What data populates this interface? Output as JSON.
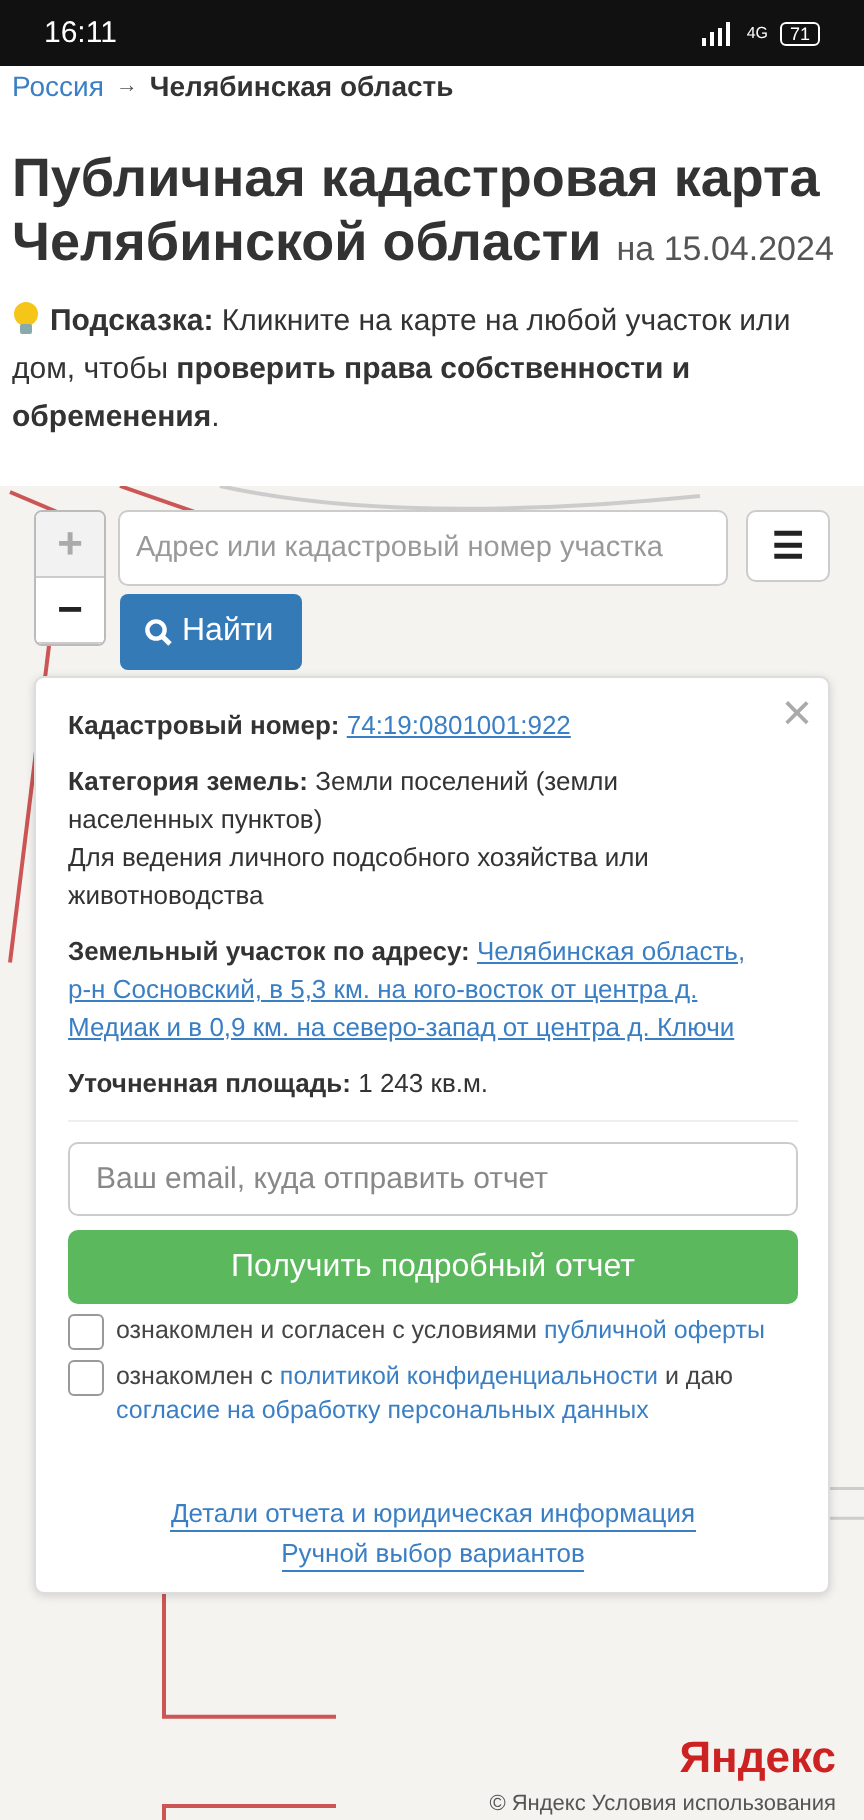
{
  "status_bar": {
    "time": "16:11",
    "network": "4G",
    "battery": "71"
  },
  "breadcrumb": [
    {
      "label": "Россия",
      "current": false
    },
    {
      "label": "Челябинская область",
      "current": true
    }
  ],
  "breadcrumb_separator": "→",
  "title": "Публичная кадастровая карта Челябинской области",
  "title_date": "на 15.04.2024",
  "hint": "**Подсказка:** Кликните на карте на любой участок или дом, чтобы **проверить права собственности и обременения**.",
  "map": {
    "zoom_in": "+",
    "zoom_out": "−",
    "search": {
      "placeholder": "Адрес или кадастровый номер участка"
    },
    "find_button": "Найти",
    "menu_button": "☰",
    "logo": "Яндекс",
    "attribution": "© Яндекс  Условия использования"
  },
  "popup": {
    "close": "×",
    "cadastral_label": "Кадастровый номер:",
    "cadastral_number": "74:19:0801001:922",
    "category_label": "Категория земель:",
    "category_value": "Земли поселений (земли населенных пунктов)",
    "usage": "Для ведения личного подсобного хозяйства или животноводства",
    "address_label": "Земельный участок по адресу:",
    "address_value": "Челябинская область, р-н Сосновский, в 5,3 км. на юго-восток от центра д. Медиак и в 0,9 км. на северо-запад от центра д. Ключи",
    "area_label": "Уточненная площадь:",
    "area_value": "1 243 кв.м.",
    "email": {
      "placeholder": "Ваш email, куда отправить отчет"
    },
    "report_button": "Получить подробный отчет",
    "agreements": [
      {
        "checked": false,
        "parts": [
          {
            "kind": "text",
            "text": "ознакомлен и согласен с условиями"
          },
          {
            "kind": "link",
            "text": "публичной оферты"
          }
        ]
      },
      {
        "checked": false,
        "parts": [
          {
            "kind": "text",
            "text": "ознакомлен с"
          },
          {
            "kind": "link",
            "text": "политикой конфиденциальности"
          },
          {
            "kind": "text",
            "text": "и даю"
          },
          {
            "kind": "link",
            "text": "согласие на обработку персональных данных"
          }
        ]
      }
    ],
    "footer_links": [
      "Детали отчета и юридическая информация",
      "Ручной выбор вариантов"
    ]
  }
}
